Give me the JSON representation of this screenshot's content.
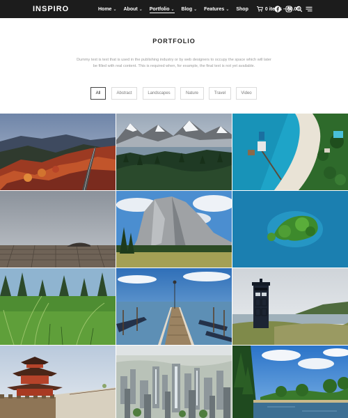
{
  "brand": {
    "logo": "INSPIRO"
  },
  "nav": {
    "items": [
      {
        "label": "Home",
        "has_dropdown": true,
        "active": false
      },
      {
        "label": "About",
        "has_dropdown": true,
        "active": false
      },
      {
        "label": "Portfolio",
        "has_dropdown": true,
        "active": true
      },
      {
        "label": "Blog",
        "has_dropdown": true,
        "active": false
      },
      {
        "label": "Features",
        "has_dropdown": true,
        "active": false
      },
      {
        "label": "Shop",
        "has_dropdown": false,
        "active": false
      }
    ],
    "cart_label": "0 items – $0.00",
    "icons": [
      "cart-icon",
      "facebook-icon",
      "instagram-icon",
      "search-icon",
      "menu-icon"
    ]
  },
  "hero": {
    "title": "PORTFOLIO",
    "description": "Dummy text is text that is used in the publishing industry or by web designers to occupy the space which will later be filled with real content. This is required when, for example, the final text is not yet available."
  },
  "filters": [
    {
      "label": "All",
      "active": true
    },
    {
      "label": "Abstract",
      "active": false
    },
    {
      "label": "Landscapes",
      "active": false
    },
    {
      "label": "Nature",
      "active": false
    },
    {
      "label": "Travel",
      "active": false
    },
    {
      "label": "Video",
      "active": false
    }
  ],
  "colors": {
    "topbar": "#1c1c1c",
    "text_dark": "#222222",
    "text_muted": "#9a9a9a",
    "filter_border": "#dcdcdc"
  }
}
